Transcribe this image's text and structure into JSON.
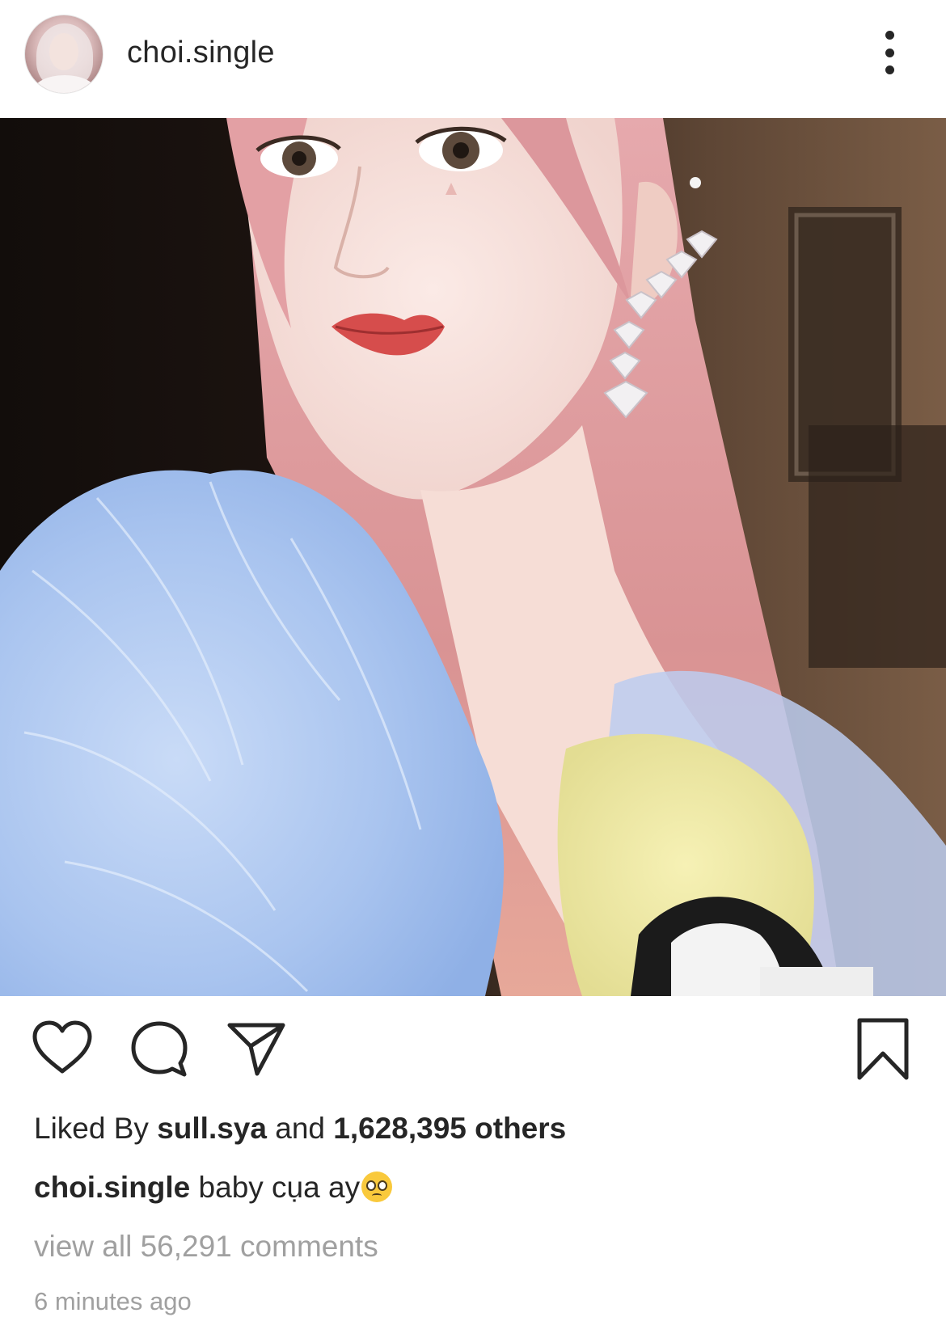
{
  "post": {
    "username": "choi.single",
    "avatar_alt": "profile-avatar",
    "more_icon": "more-vertical-icon"
  },
  "actions": {
    "like_icon": "heart-icon",
    "comment_icon": "comment-icon",
    "share_icon": "send-icon",
    "save_icon": "bookmark-icon"
  },
  "likes": {
    "prefix": "Liked By",
    "user": "sull.sya",
    "middle": "and",
    "count": "1,628,395 others"
  },
  "caption": {
    "username": "choi.single",
    "text": "baby cụa ay",
    "emoji": "pleading-face-emoji"
  },
  "comments_link": "view all 56,291 comments",
  "timestamp": "6 minutes ago"
}
